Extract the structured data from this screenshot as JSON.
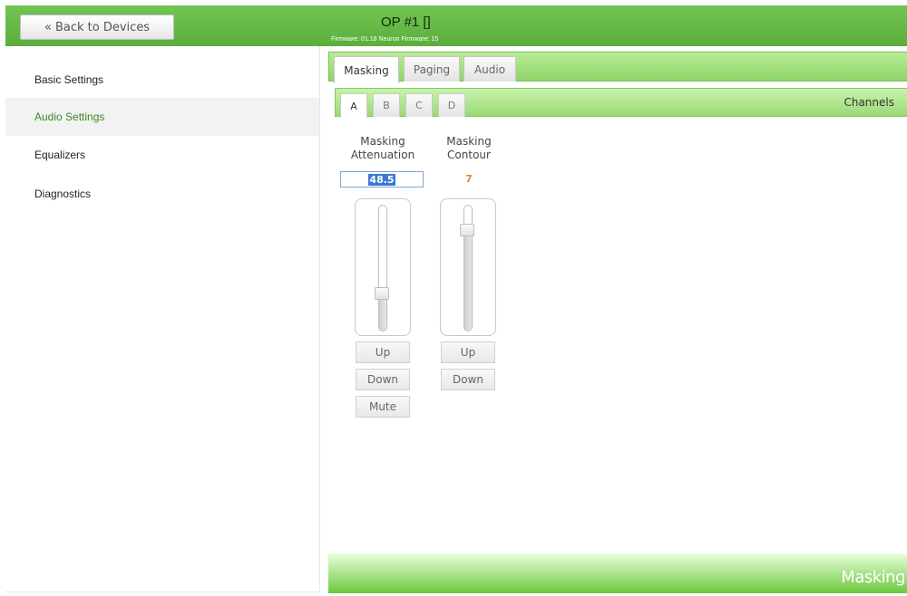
{
  "header": {
    "back_label": "« Back to Devices",
    "device_title": "OP #1 []",
    "firmware_text": "Firmware: 01.18 Neuron Firmware: 15"
  },
  "sidebar": {
    "items": [
      {
        "label": "Basic Settings"
      },
      {
        "label": "Audio Settings",
        "active": true
      },
      {
        "label": "Equalizers"
      },
      {
        "label": "Diagnostics"
      }
    ]
  },
  "tabs": [
    {
      "label": "Masking",
      "active": true
    },
    {
      "label": "Paging"
    },
    {
      "label": "Audio"
    }
  ],
  "channel_tabs": {
    "tabs": [
      "A",
      "B",
      "C",
      "D"
    ],
    "active": "A",
    "label": "Channels"
  },
  "controls": {
    "attenuation": {
      "label_line1": "Masking",
      "label_line2": "Attenuation",
      "value": "48.5",
      "level": 0.3,
      "up_label": "Up",
      "down_label": "Down",
      "mute_label": "Mute"
    },
    "contour": {
      "label_line1": "Masking",
      "label_line2": "Contour",
      "value": "7",
      "level": 0.8,
      "up_label": "Up",
      "down_label": "Down"
    }
  },
  "footer": {
    "label": "Masking"
  },
  "colors": {
    "accent_green": "#5cae3c",
    "active_sidebar_text": "#3b8a25",
    "selection_blue": "#3a78d5",
    "contour_value_orange": "#e8862e"
  }
}
